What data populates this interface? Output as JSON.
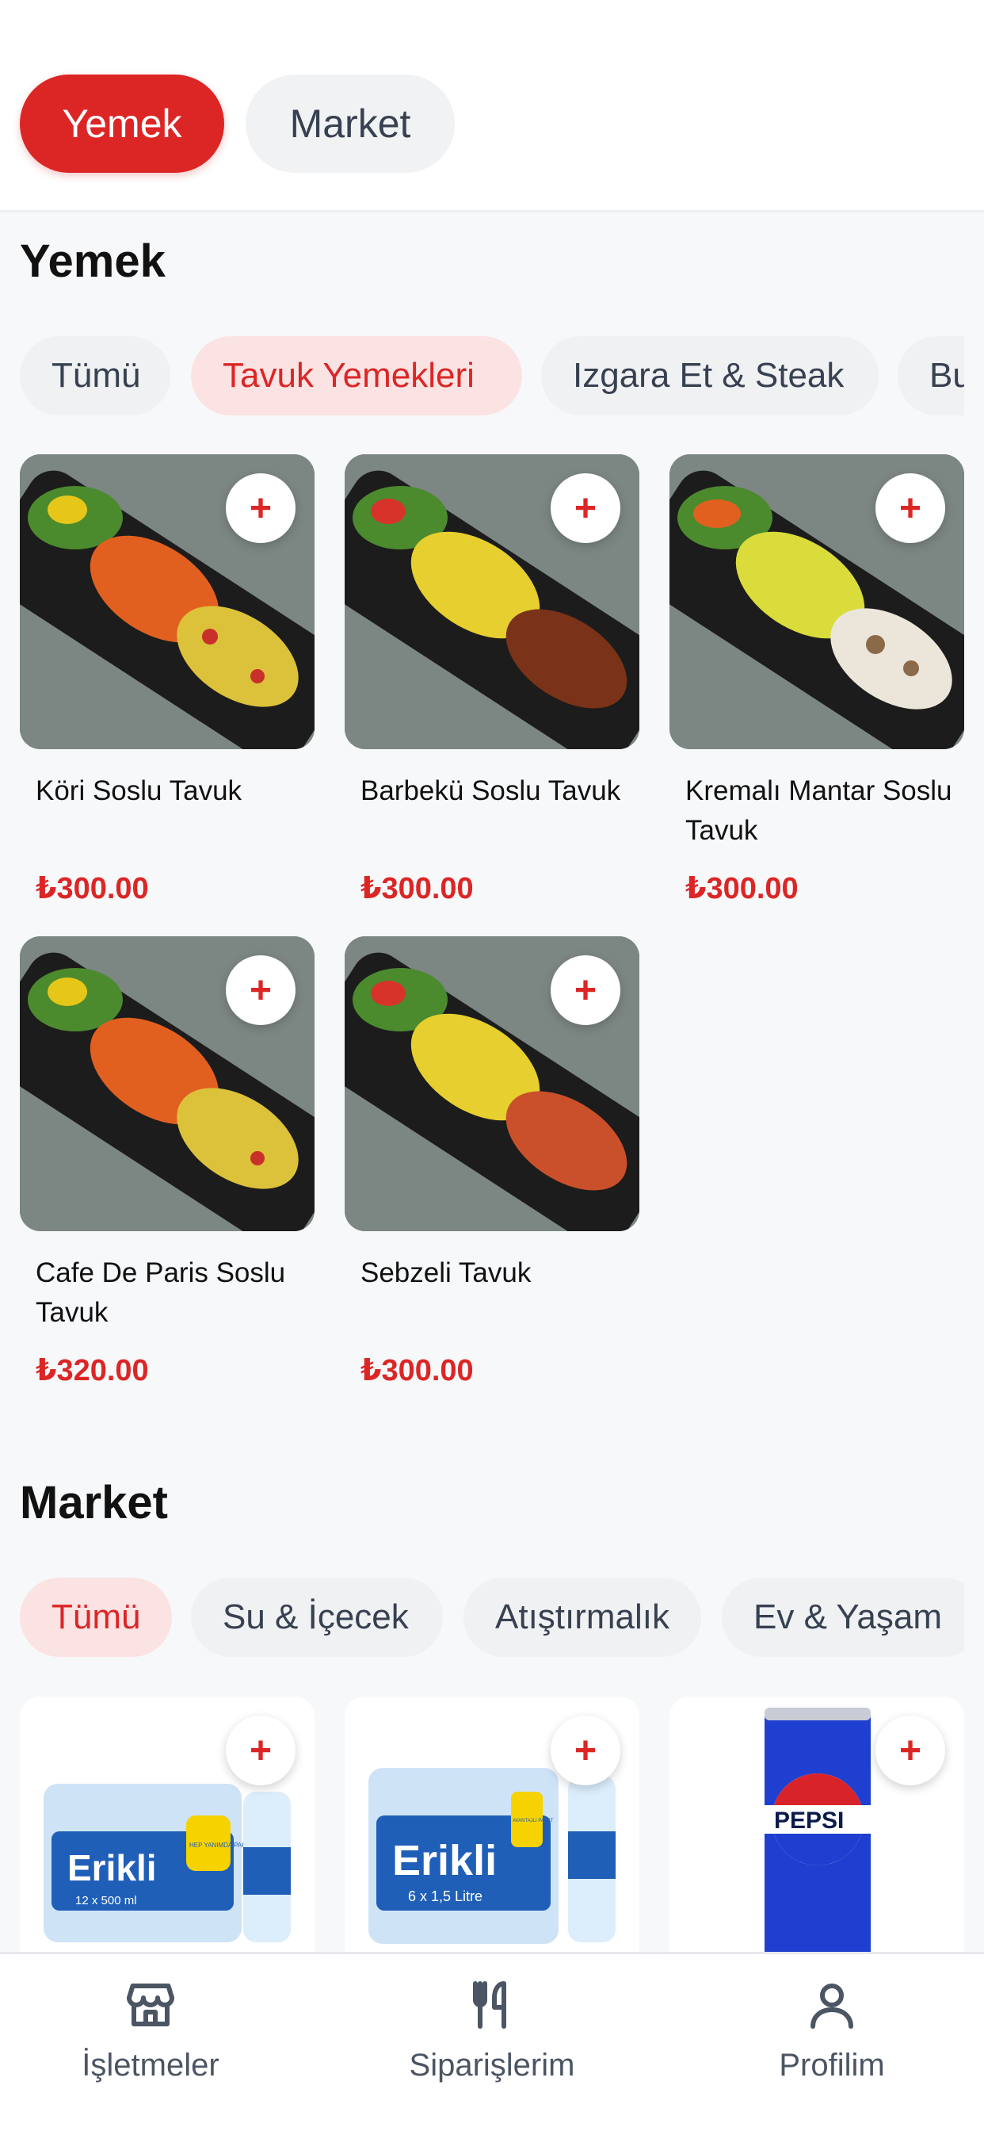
{
  "top_tabs": [
    {
      "label": "Yemek",
      "active": true
    },
    {
      "label": "Market",
      "active": false
    }
  ],
  "food_section": {
    "title": "Yemek",
    "chips": [
      "Tümü",
      "Tavuk Yemekleri",
      "Izgara Et & Steak",
      "Bu"
    ],
    "active_chip": "Tavuk Yemekleri",
    "products": [
      {
        "name": "Köri Soslu Tavuk",
        "price": "₺300.00"
      },
      {
        "name": "Barbekü Soslu Tavuk",
        "price": "₺300.00"
      },
      {
        "name": "Kremalı Mantar Soslu Tavuk",
        "price": "₺300.00"
      },
      {
        "name": "Cafe De Paris Soslu Tavuk",
        "price": "₺320.00"
      },
      {
        "name": "Sebzeli Tavuk",
        "price": "₺300.00"
      }
    ]
  },
  "market_section": {
    "title": "Market",
    "chips": [
      "Tümü",
      "Su & İçecek",
      "Atıştırmalık",
      "Ev & Yaşam"
    ],
    "active_chip": "Tümü",
    "product_images": [
      {
        "brand_text": "Erikli",
        "pack_text": "12 x 500 ml",
        "badge_text": "HEP YANIMDA PAKETİ"
      },
      {
        "brand_text": "Erikli",
        "pack_text": "6 x 1,5 Litre",
        "badge_text": "AVANTAJLI PAKET"
      },
      {
        "brand_text": "PEPSI"
      }
    ]
  },
  "add_button_symbol": "+",
  "bottom_nav": [
    {
      "label": "İşletmeler",
      "icon": "store-icon"
    },
    {
      "label": "Siparişlerim",
      "icon": "fork-knife-icon"
    },
    {
      "label": "Profilim",
      "icon": "user-icon"
    }
  ],
  "colors": {
    "accent": "#dc2626",
    "accent_soft": "#fbe3e3",
    "chip_bg": "#f0f1f3",
    "background": "#f7f8fa"
  }
}
